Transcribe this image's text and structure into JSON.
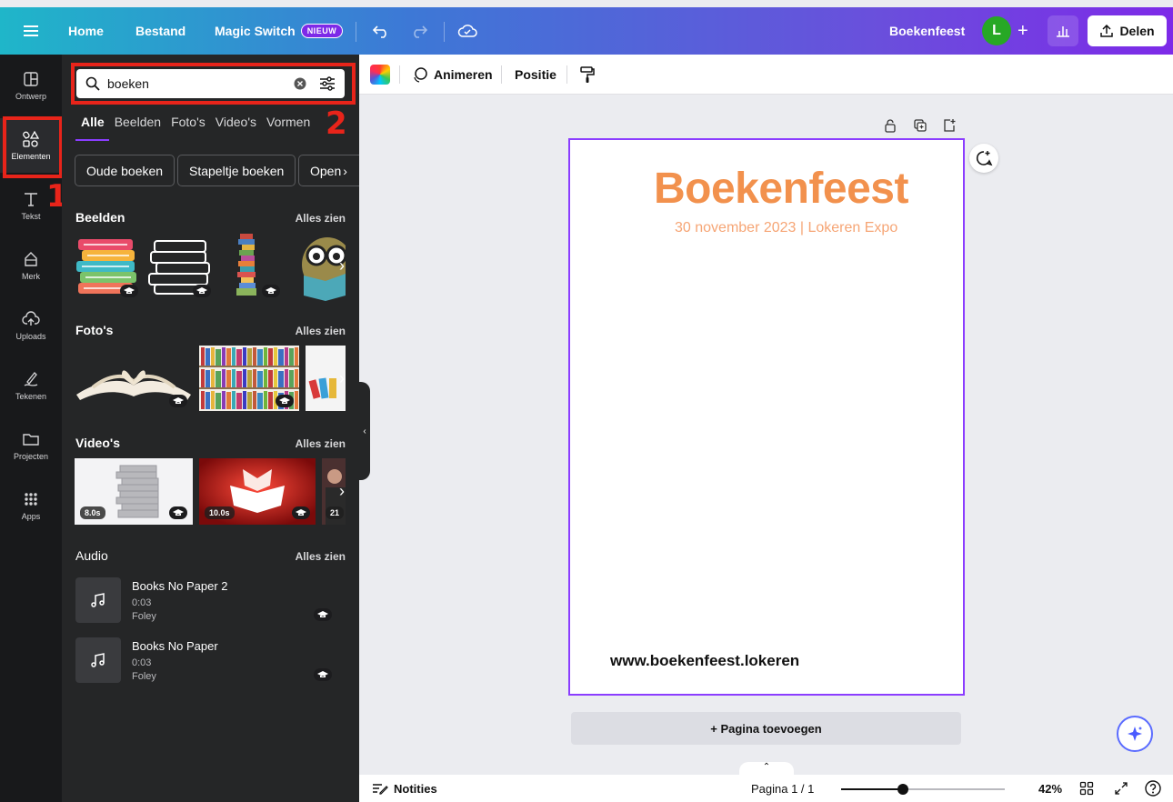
{
  "topbar": {
    "menu_icon": "hamburger-icon",
    "home": "Home",
    "file": "Bestand",
    "magic_switch": "Magic Switch",
    "magic_badge": "NIEUW",
    "design_title": "Boekenfeest",
    "avatar_letter": "L",
    "share": "Delen",
    "gradient_start": "#1fb6c9",
    "gradient_end": "#7d2ae8"
  },
  "rail": {
    "items": [
      {
        "label": "Ontwerp",
        "icon": "layout-icon"
      },
      {
        "label": "Elementen",
        "icon": "shapes-icon"
      },
      {
        "label": "Tekst",
        "icon": "text-icon"
      },
      {
        "label": "Merk",
        "icon": "brand-icon"
      },
      {
        "label": "Uploads",
        "icon": "cloud-upload-icon"
      },
      {
        "label": "Tekenen",
        "icon": "draw-icon"
      },
      {
        "label": "Projecten",
        "icon": "folder-icon"
      },
      {
        "label": "Apps",
        "icon": "apps-grid-icon"
      }
    ]
  },
  "annotations": {
    "one": "1",
    "two": "2",
    "color": "#e8241a"
  },
  "panel": {
    "search_value": "boeken",
    "tabs": [
      "Alle",
      "Beelden",
      "Foto's",
      "Video's",
      "Vormen"
    ],
    "chips": [
      "Oude boeken",
      "Stapeltje boeken",
      "Open"
    ],
    "sections": {
      "images": {
        "title": "Beelden",
        "link": "Alles zien"
      },
      "photos": {
        "title": "Foto's",
        "link": "Alles zien"
      },
      "videos": {
        "title": "Video's",
        "link": "Alles zien",
        "durations": [
          "8.0s",
          "10.0s",
          "21"
        ]
      },
      "audio": {
        "title": "Audio",
        "link": "Alles zien"
      }
    },
    "audio_items": [
      {
        "title": "Books No Paper 2",
        "duration": "0:03",
        "artist": "Foley"
      },
      {
        "title": "Books No Paper",
        "duration": "0:03",
        "artist": "Foley"
      }
    ]
  },
  "toolbar": {
    "animate": "Animeren",
    "position": "Positie"
  },
  "canvas": {
    "title": "Boekenfeest",
    "subtitle": "30 november 2023 | Lokeren Expo",
    "url": "www.boekenfeest.lokeren",
    "add_page": "+ Pagina toevoegen",
    "title_color": "#f2914d",
    "selection_color": "#8b3dff"
  },
  "footer": {
    "notes": "Notities",
    "page_indicator": "Pagina 1 / 1",
    "zoom": "42%",
    "zoom_level": 0.42
  }
}
